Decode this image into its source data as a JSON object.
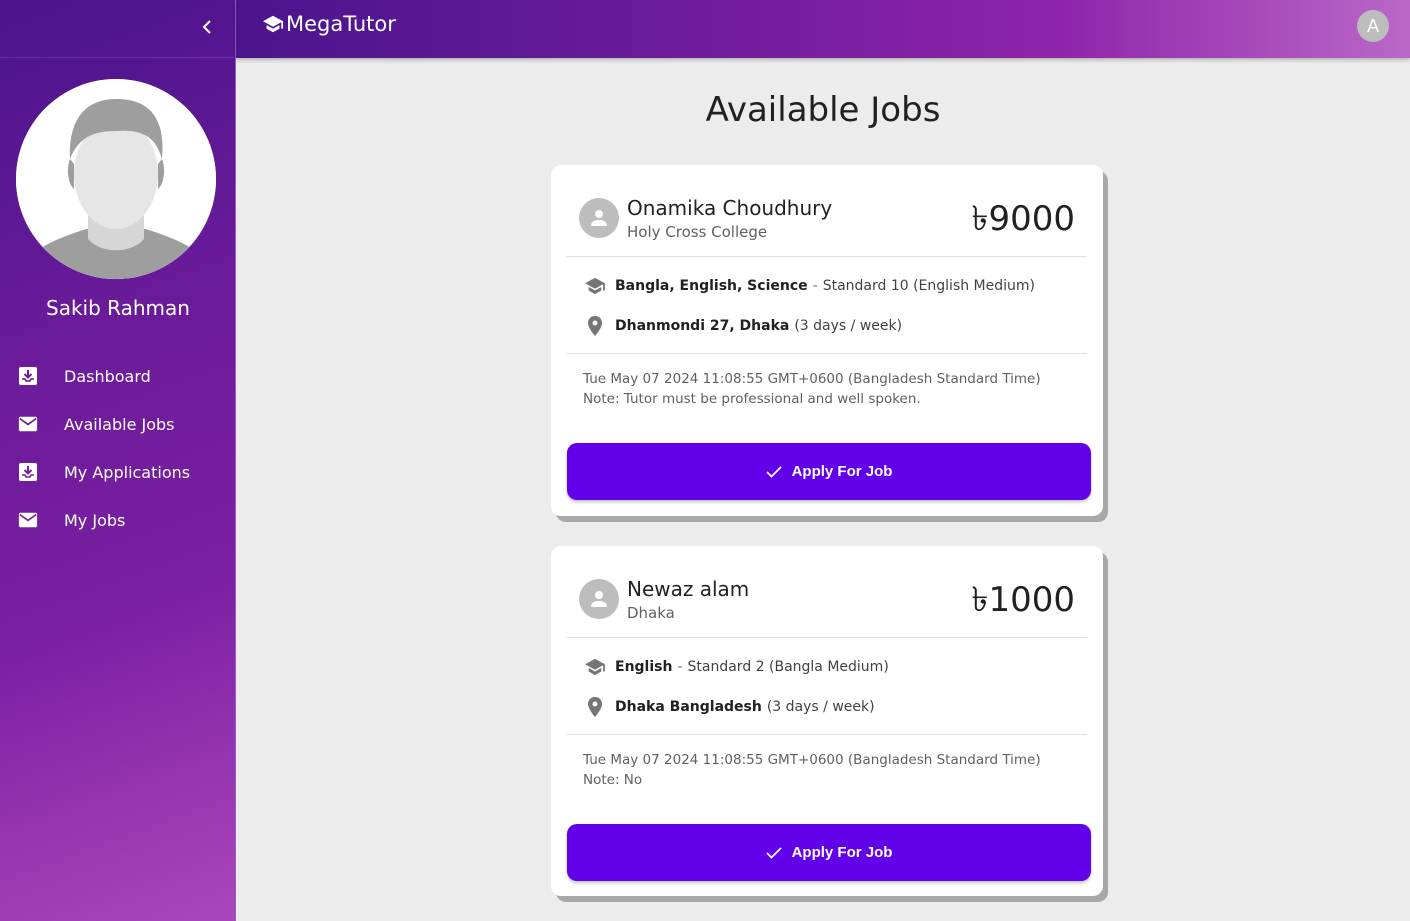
{
  "app": {
    "brand": "MegaTutor",
    "account_initial": "A"
  },
  "sidebar": {
    "user_name": "Sakib Rahman",
    "items": [
      {
        "label": "Dashboard",
        "icon": "inbox-download-icon"
      },
      {
        "label": "Available Jobs",
        "icon": "mail-icon"
      },
      {
        "label": "My Applications",
        "icon": "inbox-download-icon"
      },
      {
        "label": "My Jobs",
        "icon": "mail-icon"
      }
    ]
  },
  "main": {
    "title": "Available Jobs",
    "jobs": [
      {
        "client_name": "Onamika Choudhury",
        "client_place": "Holy Cross College",
        "salary": "৳9000",
        "subjects": "Bangla, English, Science",
        "standard": "Standard 10 (English Medium)",
        "location": "Dhanmondi 27, Dhaka",
        "frequency": "(3 days / week)",
        "date": "Tue May 07 2024 11:08:55 GMT+0600 (Bangladesh Standard Time)",
        "note": "Note: Tutor must be professional and well spoken.",
        "apply_label": "Apply For Job"
      },
      {
        "client_name": "Newaz alam",
        "client_place": "Dhaka",
        "salary": "৳1000",
        "subjects": "English",
        "standard": "Standard 2 (Bangla Medium)",
        "location": "Dhaka Bangladesh",
        "frequency": "(3 days / week)",
        "date": "Tue May 07 2024 11:08:55 GMT+0600 (Bangladesh Standard Time)",
        "note": "Note: No",
        "apply_label": "Apply For Job"
      }
    ]
  },
  "colors": {
    "primary": "#6200ea",
    "sidebar_start": "#4a148c",
    "sidebar_end": "#ab47bc"
  }
}
